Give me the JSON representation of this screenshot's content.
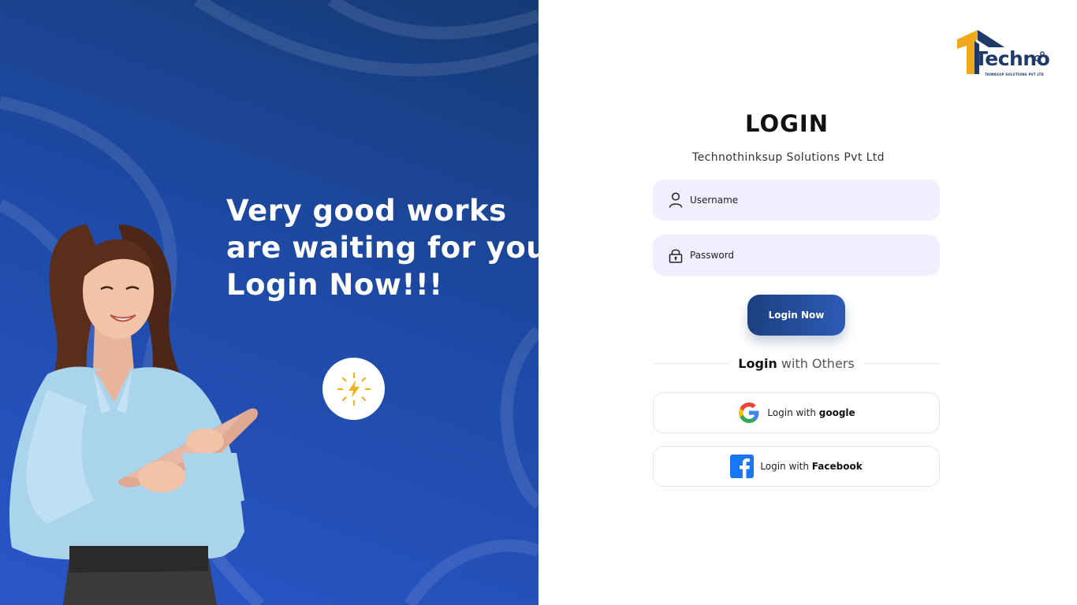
{
  "hero": {
    "headline_lines": [
      "Very good works",
      "are waiting for you",
      "Login Now!!!"
    ]
  },
  "brand": {
    "logo_text": "Techno",
    "logo_tagline": "THINKSUP SOLUTIONS PVT LTD"
  },
  "login": {
    "title": "LOGIN",
    "company": "Technothinksup Solutions Pvt Ltd",
    "username_placeholder": "Username",
    "password_placeholder": "Password",
    "submit_label": "Login Now",
    "others_bold": "Login",
    "others_rest": " with Others"
  },
  "social": {
    "google_prefix": "Login with ",
    "google_bold": "google",
    "facebook_prefix": "Login with ",
    "facebook_bold": "Facebook"
  },
  "icons": {
    "username": "user-icon",
    "password": "lock-icon",
    "bolt": "lightning-icon",
    "google": "google-icon",
    "facebook": "facebook-icon"
  },
  "colors": {
    "brand_blue": "#1d3a6b",
    "brand_orange": "#f0a81c",
    "panel_gradient_start": "#163a75",
    "panel_gradient_end": "#2a56c9",
    "field_bg": "#f1effd",
    "facebook_blue": "#1877f2"
  }
}
